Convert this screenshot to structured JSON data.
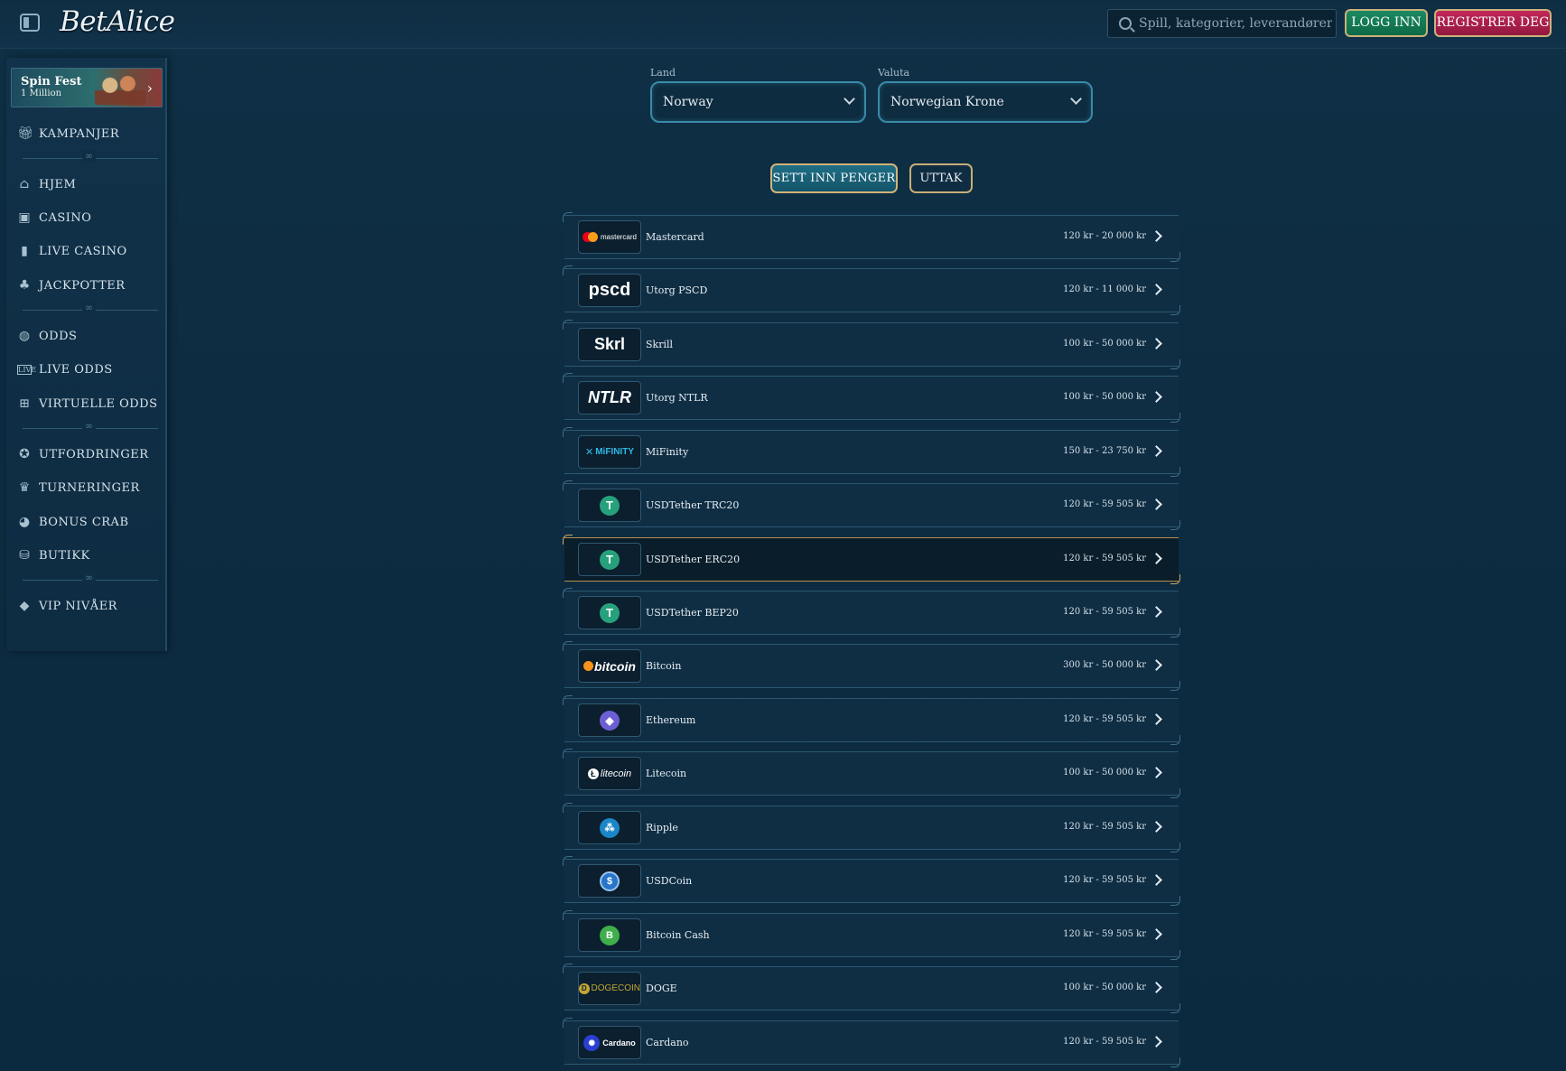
{
  "header": {
    "logo": "BetAlice",
    "search_placeholder": "Spill, kategorier, leverandører",
    "login_label": "LOGG INN",
    "register_label": "REGISTRER DEG"
  },
  "sidebar": {
    "promo": {
      "title": "Spin Fest",
      "subtitle": "1 Million"
    },
    "items": [
      {
        "label": "KAMPANJER",
        "icon": "gift-icon"
      },
      {
        "label": "HJEM",
        "icon": "home-icon"
      },
      {
        "label": "CASINO",
        "icon": "slot-machine-icon"
      },
      {
        "label": "LIVE CASINO",
        "icon": "cards-icon"
      },
      {
        "label": "JACKPOTTER",
        "icon": "clover-icon"
      },
      {
        "label": "ODDS",
        "icon": "ball-icon"
      },
      {
        "label": "LIVE ODDS",
        "icon": "live-icon"
      },
      {
        "label": "VIRTUELLE ODDS",
        "icon": "virtual-icon"
      },
      {
        "label": "UTFORDRINGER",
        "icon": "challenge-icon"
      },
      {
        "label": "TURNERINGER",
        "icon": "trophy-icon"
      },
      {
        "label": "BONUS CRAB",
        "icon": "crab-icon"
      },
      {
        "label": "BUTIKK",
        "icon": "basket-icon"
      },
      {
        "label": "VIP NIVÅER",
        "icon": "diamond-icon"
      }
    ]
  },
  "filters": {
    "country_label": "Land",
    "country_value": "Norway",
    "currency_label": "Valuta",
    "currency_value": "Norwegian Krone"
  },
  "tabs": {
    "deposit": "SETT INN PENGER",
    "withdraw": "UTTAK"
  },
  "payments": [
    {
      "name": "Mastercard",
      "range": "120 kr - 20 000 kr",
      "logo": "mastercard",
      "logo_text": "mastercard"
    },
    {
      "name": "Utorg PSCD",
      "range": "120 kr - 11 000 kr",
      "logo": "pscd",
      "logo_text": "pscd"
    },
    {
      "name": "Skrill",
      "range": "100 kr - 50 000 kr",
      "logo": "skrill",
      "logo_text": "Skrl"
    },
    {
      "name": "Utorg NTLR",
      "range": "100 kr - 50 000 kr",
      "logo": "ntlr",
      "logo_text": "NTLR"
    },
    {
      "name": "MiFinity",
      "range": "150 kr - 23 750 kr",
      "logo": "mifinity",
      "logo_text": "MiFINITY"
    },
    {
      "name": "USDTether TRC20",
      "range": "120 kr - 59 505 kr",
      "logo": "tether",
      "logo_text": "T"
    },
    {
      "name": "USDTether ERC20",
      "range": "120 kr - 59 505 kr",
      "logo": "tether",
      "logo_text": "T"
    },
    {
      "name": "USDTether BEP20",
      "range": "120 kr - 59 505 kr",
      "logo": "tether",
      "logo_text": "T"
    },
    {
      "name": "Bitcoin",
      "range": "300 kr - 50 000 kr",
      "logo": "bitcoin",
      "logo_text": "bitcoin"
    },
    {
      "name": "Ethereum",
      "range": "120 kr - 59 505 kr",
      "logo": "ethereum",
      "logo_text": ""
    },
    {
      "name": "Litecoin",
      "range": "100 kr - 50 000 kr",
      "logo": "litecoin",
      "logo_text": "litecoin"
    },
    {
      "name": "Ripple",
      "range": "120 kr - 59 505 kr",
      "logo": "ripple",
      "logo_text": ""
    },
    {
      "name": "USDCoin",
      "range": "120 kr - 59 505 kr",
      "logo": "usdc",
      "logo_text": "$"
    },
    {
      "name": "Bitcoin Cash",
      "range": "120 kr - 59 505 kr",
      "logo": "bch",
      "logo_text": "B"
    },
    {
      "name": "DOGE",
      "range": "100 kr - 50 000 kr",
      "logo": "doge",
      "logo_text": "DOGECOIN"
    },
    {
      "name": "Cardano",
      "range": "120 kr - 59 505 kr",
      "logo": "cardano",
      "logo_text": "Cardano"
    }
  ],
  "colors": {
    "background": "#0d2b41",
    "accent_gold": "#c9a463",
    "login_green": "#1b8a62",
    "register_red": "#c2275a",
    "deposit_teal": "#1e6e86"
  }
}
